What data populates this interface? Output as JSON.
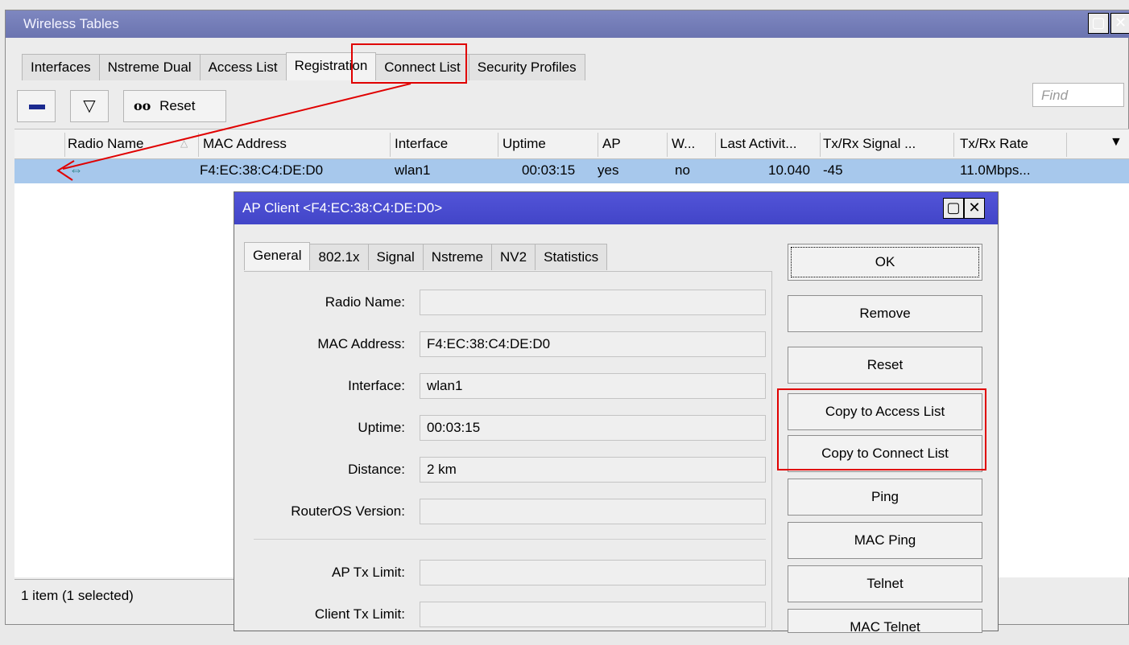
{
  "window": {
    "title": "Wireless Tables"
  },
  "tabs": [
    "Interfaces",
    "Nstreme Dual",
    "Access List",
    "Registration",
    "Connect List",
    "Security Profiles"
  ],
  "active_tab": "Registration",
  "toolbar": {
    "reset_label": "Reset",
    "reset_prefix": "oo",
    "find_placeholder": "Find"
  },
  "table": {
    "columns": [
      "Radio Name",
      "MAC Address",
      "Interface",
      "Uptime",
      "AP",
      "W...",
      "Last Activit...",
      "Tx/Rx Signal ...",
      "Tx/Rx Rate"
    ],
    "rows": [
      {
        "radio_name": "",
        "mac": "F4:EC:38:C4:DE:D0",
        "interface": "wlan1",
        "uptime": "00:03:15",
        "ap": "yes",
        "w": "no",
        "last_activity": "10.040",
        "signal": "-45",
        "rate": "11.0Mbps..."
      }
    ]
  },
  "status": "1 item (1 selected)",
  "dialog": {
    "title": "AP Client <F4:EC:38:C4:DE:D0>",
    "tabs": [
      "General",
      "802.1x",
      "Signal",
      "Nstreme",
      "NV2",
      "Statistics"
    ],
    "active_tab": "General",
    "fields": [
      {
        "label": "Radio Name:",
        "value": ""
      },
      {
        "label": "MAC Address:",
        "value": "F4:EC:38:C4:DE:D0"
      },
      {
        "label": "Interface:",
        "value": "wlan1"
      },
      {
        "label": "Uptime:",
        "value": "00:03:15"
      },
      {
        "label": "Distance:",
        "value": "2 km"
      },
      {
        "label": "RouterOS Version:",
        "value": ""
      },
      {
        "label": "AP Tx Limit:",
        "value": ""
      },
      {
        "label": "Client Tx Limit:",
        "value": ""
      }
    ],
    "buttons": [
      "OK",
      "Remove",
      "Reset",
      "Copy to Access List",
      "Copy to Connect List",
      "Ping",
      "MAC Ping",
      "Telnet",
      "MAC Telnet"
    ]
  },
  "colors": {
    "highlight": "#e00000",
    "selected_row": "#a7c8ec",
    "dialog_title": "#4245c8"
  }
}
